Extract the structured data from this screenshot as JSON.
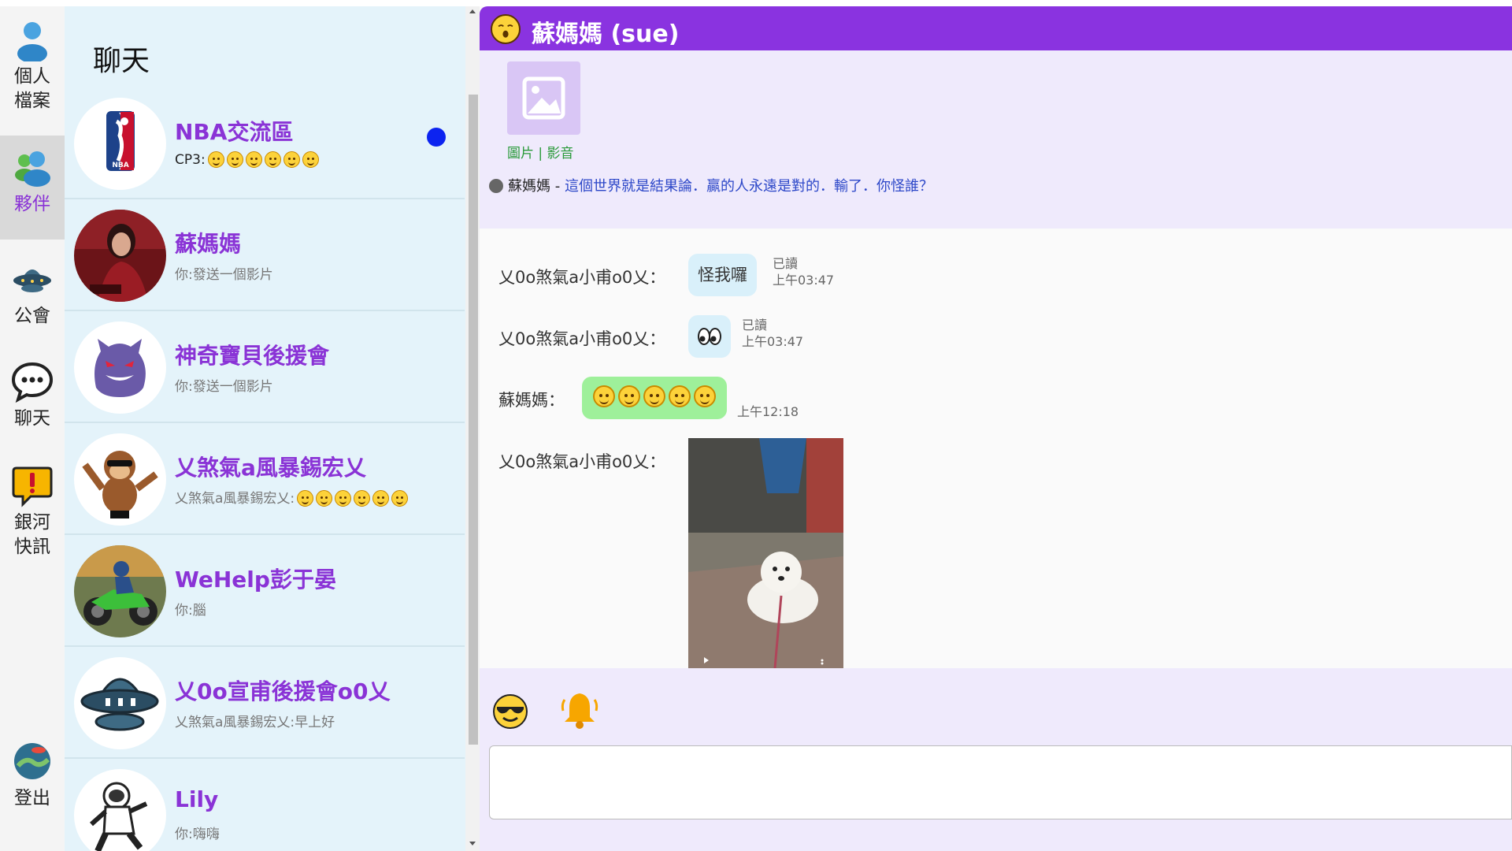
{
  "colors": {
    "accent": "#8a33e0",
    "name_purple": "#8a33d6",
    "list_bg": "#e4f3fa",
    "unread": "#0c23f0",
    "bubble": "#d9f0fa",
    "bubble_green": "#9ef09a"
  },
  "nav": {
    "items": [
      {
        "label_1": "個人",
        "label_2": "檔案",
        "icon": "user-icon",
        "active": false
      },
      {
        "label_1": "夥伴",
        "icon": "friends-icon",
        "active": true
      },
      {
        "label_1": "公會",
        "icon": "ufo-icon",
        "active": false
      },
      {
        "label_1": "聊天",
        "icon": "chat-bubble-icon",
        "active": false
      },
      {
        "label_1": "銀河",
        "label_2": "快訊",
        "icon": "alert-icon",
        "active": false
      },
      {
        "label_1": "登出",
        "icon": "planet-icon",
        "active": false
      }
    ]
  },
  "list": {
    "title": "聊天",
    "chats": [
      {
        "name": "NBA交流區",
        "preview": "CP3:",
        "preview_emoji_count": 6,
        "unread": true,
        "avatar": "nba-logo"
      },
      {
        "name": "蘇媽媽",
        "preview": "你:發送一個影片",
        "avatar": "woman-photo"
      },
      {
        "name": "神奇寶貝後援會",
        "preview": "你:發送一個影片",
        "avatar": "gengar"
      },
      {
        "name": "乂煞氣a風暴錫宏乂",
        "preview": "乂煞氣a風暴錫宏乂:",
        "preview_emoji_count": 6,
        "avatar": "monkey"
      },
      {
        "name": "WeHelp彭于晏",
        "preview": "你:腦",
        "avatar": "motorbike-photo"
      },
      {
        "name": "乂0o宣甫後援會o0乂",
        "preview": "乂煞氣a風暴錫宏乂:早上好",
        "avatar": "ufo"
      },
      {
        "name": "Lily",
        "preview": "你:嗨嗨",
        "avatar": "astronaut"
      }
    ]
  },
  "conv": {
    "title": "蘇媽媽 (sue)",
    "media_link": "圖片 | 影音",
    "status_name": "蘇媽媽 - ",
    "status_quote": "這個世界就是結果論．贏的人永遠是對的．輸了．你怪誰？",
    "messages": [
      {
        "sender": "乂0o煞氣a小甫o0乂：",
        "text": "怪我囉",
        "read": "已讀",
        "time": "上午03:47"
      },
      {
        "sender": "乂0o煞氣a小甫o0乂：",
        "text": "👀",
        "read": "已讀",
        "time": "上午03:47"
      },
      {
        "sender": "蘇媽媽：",
        "emoji_count": 5,
        "time": "上午12:18"
      },
      {
        "sender": "乂0o煞氣a小甫o0乂：",
        "attachment": "dog-video"
      }
    ],
    "input_placeholder": ""
  }
}
